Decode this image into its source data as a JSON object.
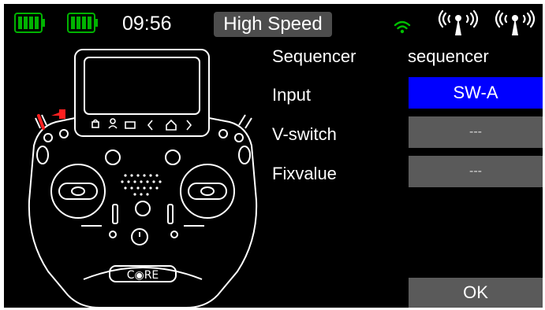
{
  "status_bar": {
    "clock": "09:56",
    "mode": "High Speed",
    "battery_color": "#00b300",
    "wifi_color": "#00c000"
  },
  "transmitter": {
    "brand_label": "C◉RE"
  },
  "form": {
    "sequencer_label": "Sequencer",
    "sequencer_value": "sequencer",
    "input_label": "Input",
    "input_value": "SW-A",
    "vswitch_label": "V-switch",
    "vswitch_value": "---",
    "fixvalue_label": "Fixvalue",
    "fixvalue_value": "---"
  },
  "buttons": {
    "ok_label": "OK"
  },
  "colors": {
    "selected_field": "#0000ff",
    "inactive_field": "#5a5a5a",
    "mode_badge": "#4d4d4d"
  }
}
